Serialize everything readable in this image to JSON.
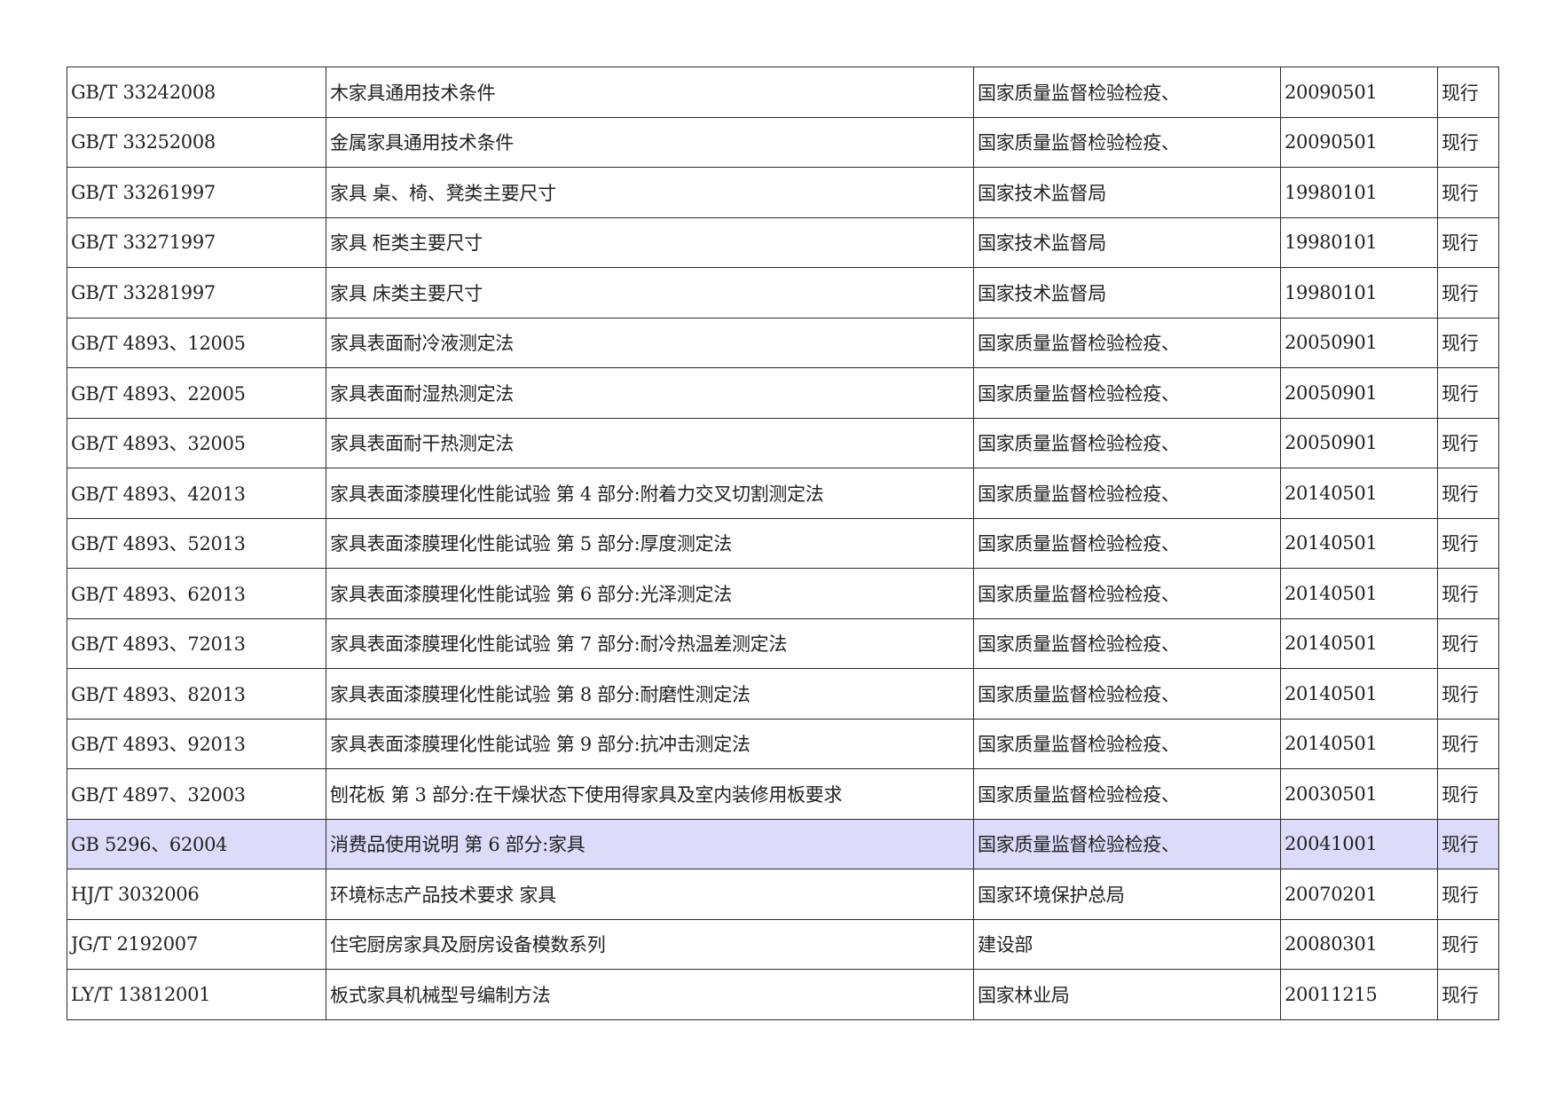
{
  "table": {
    "rows": [
      {
        "code": "GB/T 33242008",
        "name": "木家具通用技术条件",
        "org": "国家质量监督检验检疫、",
        "date": "20090501",
        "status": "现行",
        "highlight": false
      },
      {
        "code": "GB/T 33252008",
        "name": "金属家具通用技术条件",
        "org": "国家质量监督检验检疫、",
        "date": "20090501",
        "status": "现行",
        "highlight": false
      },
      {
        "code": "GB/T 33261997",
        "name": "家具 桌、椅、凳类主要尺寸",
        "org": "国家技术监督局",
        "date": "19980101",
        "status": "现行",
        "highlight": false
      },
      {
        "code": "GB/T 33271997",
        "name": "家具 柜类主要尺寸",
        "org": "国家技术监督局",
        "date": "19980101",
        "status": "现行",
        "highlight": false
      },
      {
        "code": "GB/T 33281997",
        "name": "家具 床类主要尺寸",
        "org": "国家技术监督局",
        "date": "19980101",
        "status": "现行",
        "highlight": false
      },
      {
        "code": "GB/T 4893、12005",
        "name": "家具表面耐冷液测定法",
        "org": "国家质量监督检验检疫、",
        "date": "20050901",
        "status": "现行",
        "highlight": false
      },
      {
        "code": "GB/T 4893、22005",
        "name": "家具表面耐湿热测定法",
        "org": "国家质量监督检验检疫、",
        "date": "20050901",
        "status": "现行",
        "highlight": false
      },
      {
        "code": "GB/T 4893、32005",
        "name": "家具表面耐干热测定法",
        "org": "国家质量监督检验检疫、",
        "date": "20050901",
        "status": "现行",
        "highlight": false
      },
      {
        "code": "GB/T 4893、42013",
        "name": "家具表面漆膜理化性能试验 第 4 部分:附着力交叉切割测定法",
        "org": "国家质量监督检验检疫、",
        "date": "20140501",
        "status": "现行",
        "highlight": false
      },
      {
        "code": "GB/T 4893、52013",
        "name": "家具表面漆膜理化性能试验 第 5 部分:厚度测定法",
        "org": "国家质量监督检验检疫、",
        "date": "20140501",
        "status": "现行",
        "highlight": false
      },
      {
        "code": "GB/T 4893、62013",
        "name": "家具表面漆膜理化性能试验 第 6 部分:光泽测定法",
        "org": "国家质量监督检验检疫、",
        "date": "20140501",
        "status": "现行",
        "highlight": false
      },
      {
        "code": "GB/T 4893、72013",
        "name": "家具表面漆膜理化性能试验 第 7 部分:耐冷热温差测定法",
        "org": "国家质量监督检验检疫、",
        "date": "20140501",
        "status": "现行",
        "highlight": false
      },
      {
        "code": "GB/T 4893、82013",
        "name": "家具表面漆膜理化性能试验 第 8 部分:耐磨性测定法",
        "org": "国家质量监督检验检疫、",
        "date": "20140501",
        "status": "现行",
        "highlight": false
      },
      {
        "code": "GB/T 4893、92013",
        "name": "家具表面漆膜理化性能试验 第 9 部分:抗冲击测定法",
        "org": "国家质量监督检验检疫、",
        "date": "20140501",
        "status": "现行",
        "highlight": false
      },
      {
        "code": "GB/T 4897、32003",
        "name": "刨花板 第 3 部分:在干燥状态下使用得家具及室内装修用板要求",
        "org": "国家质量监督检验检疫、",
        "date": "20030501",
        "status": "现行",
        "highlight": false
      },
      {
        "code": "GB 5296、62004",
        "name": "消费品使用说明 第 6 部分:家具",
        "org": "国家质量监督检验检疫、",
        "date": "20041001",
        "status": "现行",
        "highlight": true
      },
      {
        "code": "HJ/T 3032006",
        "name": "环境标志产品技术要求 家具",
        "org": "国家环境保护总局",
        "date": "20070201",
        "status": "现行",
        "highlight": false
      },
      {
        "code": "JG/T 2192007",
        "name": "住宅厨房家具及厨房设备模数系列",
        "org": "建设部",
        "date": "20080301",
        "status": "现行",
        "highlight": false
      },
      {
        "code": "LY/T 13812001",
        "name": "板式家具机械型号编制方法",
        "org": "国家林业局",
        "date": "20011215",
        "status": "现行",
        "highlight": false
      }
    ],
    "colors": {
      "highlight_row": "#dcdcfa",
      "border": "#2a2a2a",
      "text": "#222222"
    }
  }
}
